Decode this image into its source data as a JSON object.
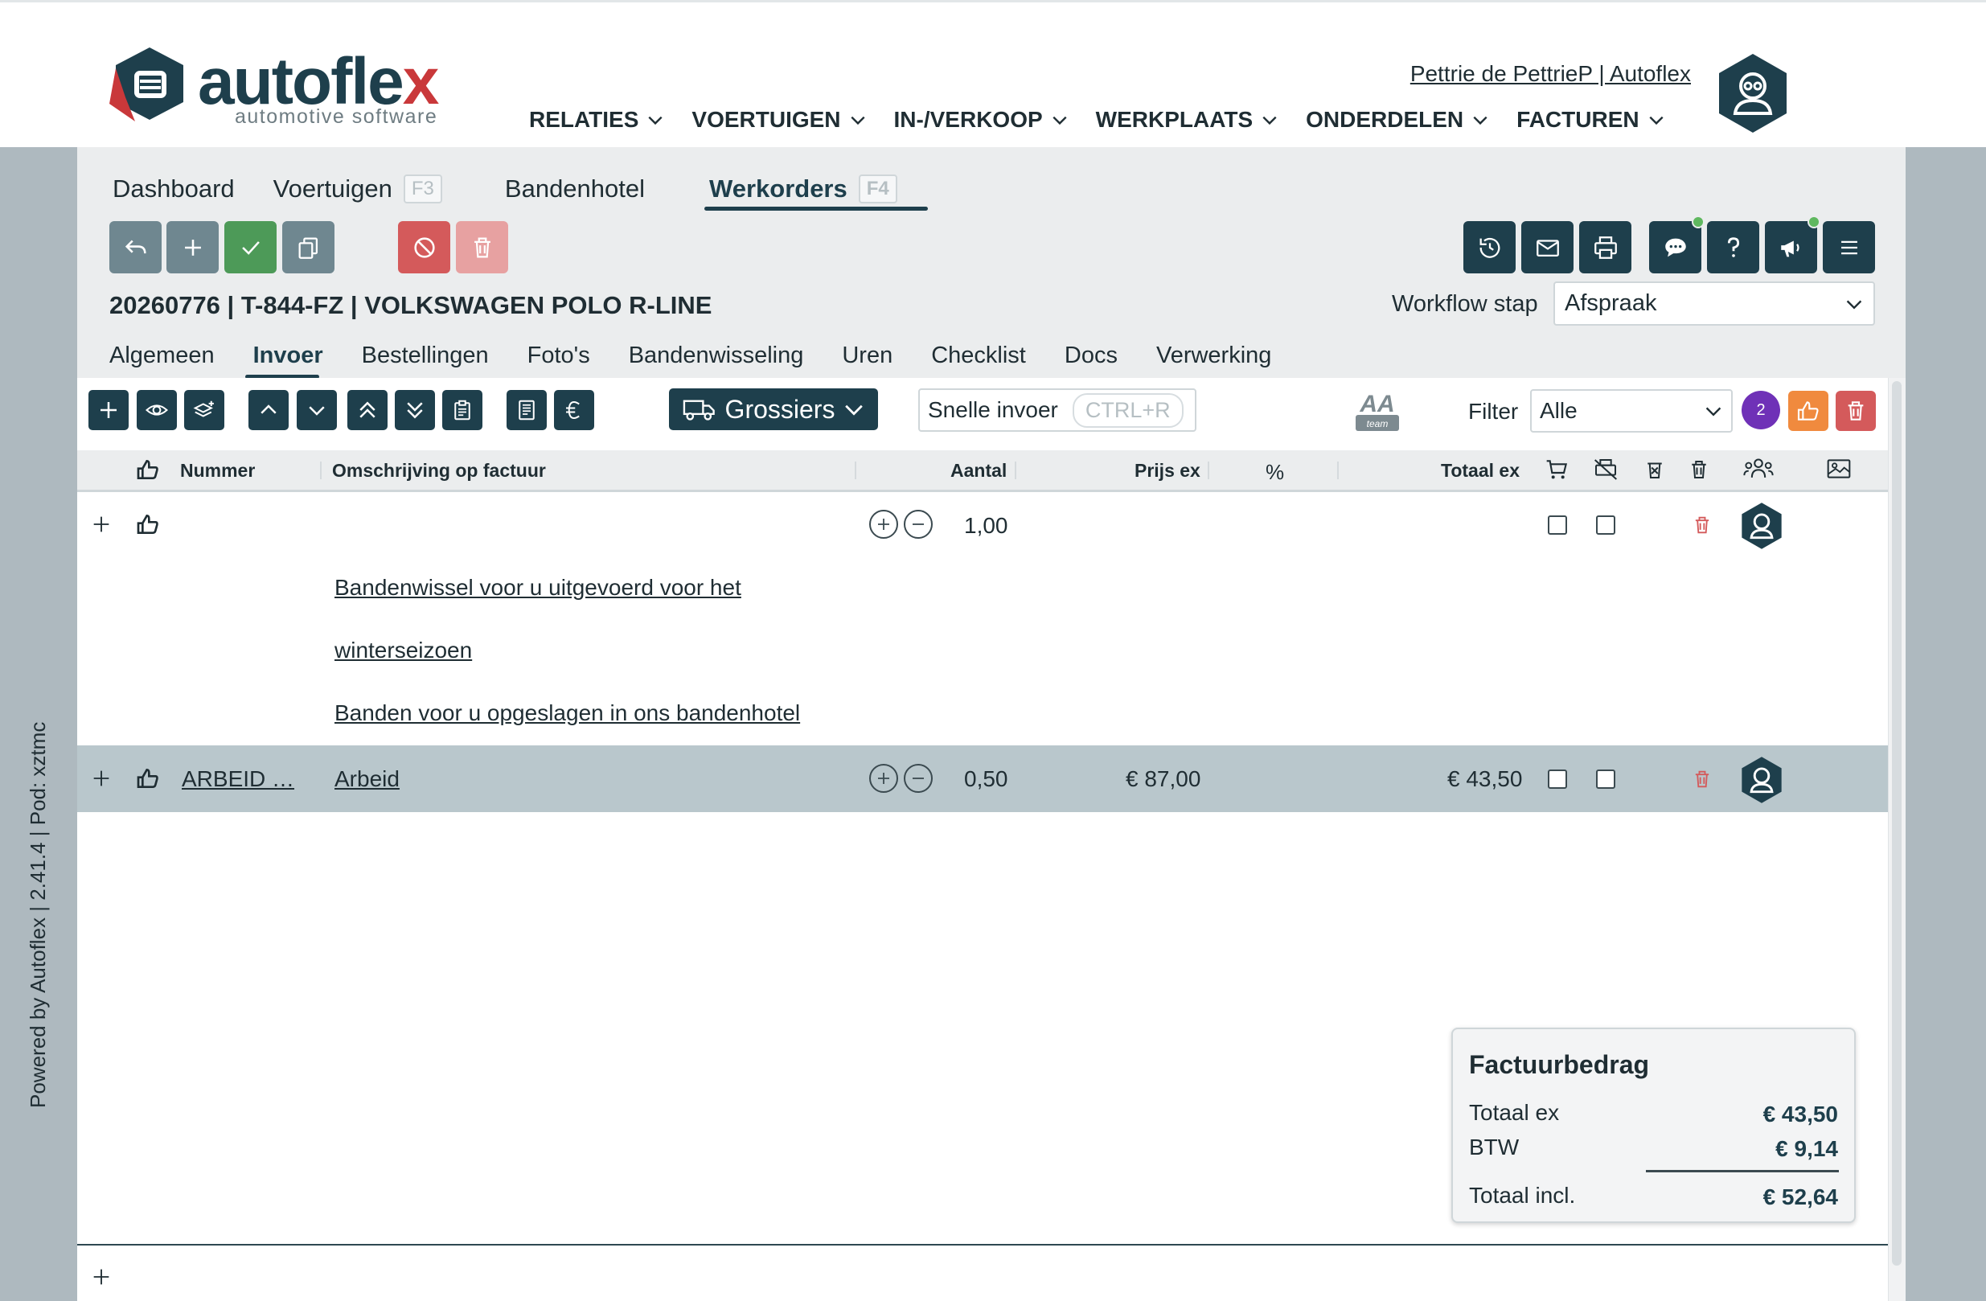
{
  "brand": {
    "name_part1": "autofle",
    "name_part2": "x",
    "tagline": "automotive software"
  },
  "user": {
    "link_text": "Pettrie de PettrieP | Autoflex"
  },
  "main_nav": [
    "RELATIES",
    "VOERTUIGEN",
    "IN-/VERKOOP",
    "WERKPLAATS",
    "ONDERDELEN",
    "FACTUREN"
  ],
  "side_text": "Powered by Autoflex | 2.41.4 | Pod: xztmc",
  "top_tabs": [
    {
      "label": "Dashboard"
    },
    {
      "label": "Voertuigen",
      "key": "F3"
    },
    {
      "label": "Bandenhotel"
    },
    {
      "label": "Werkorders",
      "key": "F4"
    }
  ],
  "workorder": {
    "title": "20260776 | T-844-FZ | VOLKSWAGEN POLO R-LINE",
    "workflow_label": "Workflow stap",
    "workflow_value": "Afspraak"
  },
  "sub_tabs": [
    "Algemeen",
    "Invoer",
    "Bestellingen",
    "Foto's",
    "Bandenwisseling",
    "Uren",
    "Checklist",
    "Docs",
    "Verwerking"
  ],
  "toolbar": {
    "grossiers_label": "Grossiers",
    "quick_input_label": "Snelle invoer",
    "quick_input_key": "CTRL+R",
    "aa_logo_text": "AA",
    "aa_logo_sub": "team",
    "filter_label": "Filter",
    "filter_value": "Alle",
    "badge_count": "2"
  },
  "table": {
    "headers": {
      "nummer": "Nummer",
      "omschrijving": "Omschrijving op factuur",
      "aantal": "Aantal",
      "prijs": "Prijs ex",
      "pct": "%",
      "totaal": "Totaal ex"
    },
    "rows": [
      {
        "nummer": "",
        "aantal": "1,00",
        "prijs": "",
        "totaal": "",
        "lines": [
          "Bandenwissel voor u uitgevoerd voor het ",
          "winterseizoen",
          "Banden voor u opgeslagen in ons bandenhotel"
        ]
      },
      {
        "nummer": "ARBEID …",
        "omschrijving": "Arbeid",
        "aantal": "0,50",
        "prijs": "€ 87,00",
        "totaal": "€ 43,50"
      }
    ]
  },
  "invoice": {
    "title": "Factuurbedrag",
    "total_ex_label": "Totaal ex",
    "total_ex_value": "€ 43,50",
    "btw_label": "BTW",
    "btw_value": "€ 9,14",
    "total_incl_label": "Totaal incl.",
    "total_incl_value": "€ 52,64"
  },
  "colors": {
    "primary": "#1e3f4c",
    "success": "#4d9a58",
    "danger": "#d45a5b",
    "accent_orange": "#f08a3e",
    "badge_purple": "#6f31b7"
  }
}
